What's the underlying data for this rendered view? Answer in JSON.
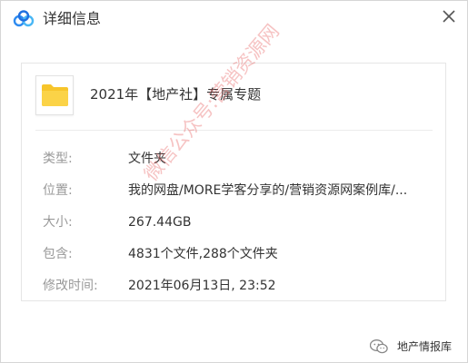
{
  "window": {
    "title": "详细信息",
    "app_icon": "baidu-netdisk-cloud-icon",
    "close_icon": "close-icon"
  },
  "item": {
    "icon": "folder-icon",
    "name": "2021年【地产社】专属专题"
  },
  "properties": [
    {
      "label": "类型:",
      "value": "文件夹"
    },
    {
      "label": "位置:",
      "value": "我的网盘/MORE学客分享的/营销资源网案例库/..."
    },
    {
      "label": "大小:",
      "value": "267.44GB"
    },
    {
      "label": "包含:",
      "value": "4831个文件,288个文件夹"
    },
    {
      "label": "修改时间:",
      "value": "2021年06月13日, 23:52"
    }
  ],
  "watermark": "微信公众号:营销资源网",
  "footer": {
    "brand_icon": "wechat-icon",
    "brand_text": "地产情报库"
  },
  "colors": {
    "folder": "#f7c52b",
    "label": "#999999",
    "value": "#333333",
    "watermark": "#e86060",
    "cloud_blue": "#2e8bf0"
  }
}
